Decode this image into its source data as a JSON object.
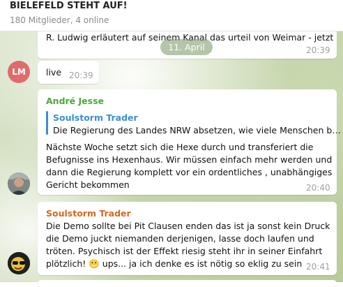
{
  "header": {
    "title": "BIELEFELD STEHT AUF!",
    "subtitle": "180 Mitglieder, 4 online"
  },
  "date_separator": "11. April",
  "messages": [
    {
      "text_lines": [
        "R. Ludwig erläutert auf seinem Kanal das urteil von Weimar - jetzt"
      ],
      "time": "20:39"
    },
    {
      "avatar_initials": "LM",
      "avatar_color": "#e06b6b",
      "text_lines": [
        "live"
      ],
      "time": "20:39"
    },
    {
      "sender": "André Jesse",
      "sender_color": "#4aa83a",
      "reply": {
        "author": "Soulstorm Trader",
        "text": "Die Regierung des Landes NRW absetzen, wie viele Menschen b…"
      },
      "text_lines": [
        "Nächste Woche setzt sich die Hexe durch und transferiert die",
        "Befugnisse ins Hexenhaus. Wir müssen einfach mehr werden und",
        "dann die Regierung komplett vor ein ordentliches , unabhängiges",
        "Gericht bekommen"
      ],
      "time": "20:40"
    },
    {
      "sender": "Soulstorm Trader",
      "sender_color": "#d2691e",
      "text_lines": [
        "Die Demo sollte bei Pit Clausen enden das ist ja sonst kein Druck",
        "die Demo juckt niemanden derjenigen, lasse doch laufen und",
        "tröten. Psychisch ist der Effekt riesig steht ihr in seiner Einfahrt",
        "plötzlich! 😬 ups... ja ich denke es ist nötig so eklig zu sein"
      ],
      "time": "20:41"
    }
  ],
  "colors": {
    "reply_author": "#3a8fd1",
    "accent_green": "#4aa83a",
    "accent_orange": "#d2691e"
  }
}
